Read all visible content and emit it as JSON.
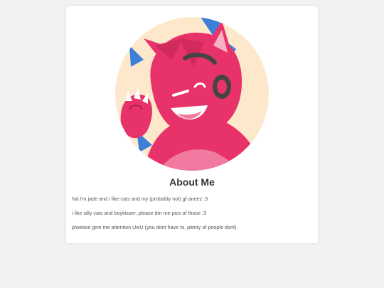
{
  "profile": {
    "heading": "About Me",
    "lines": [
      "hai i'm jade and i like cats and my (probably not) gf aneez :3",
      "i like silly cats and boykisser, please dm me pics of those :3",
      "plwease give me attention UwU (you dont have to, plenty of people dont)"
    ],
    "avatar": {
      "icon": "fox-character-avatar",
      "background_color": "#fde8cc",
      "fur_color": "#e8336a",
      "accent_color": "#3b7fd9",
      "headphone_color": "#444444"
    }
  }
}
